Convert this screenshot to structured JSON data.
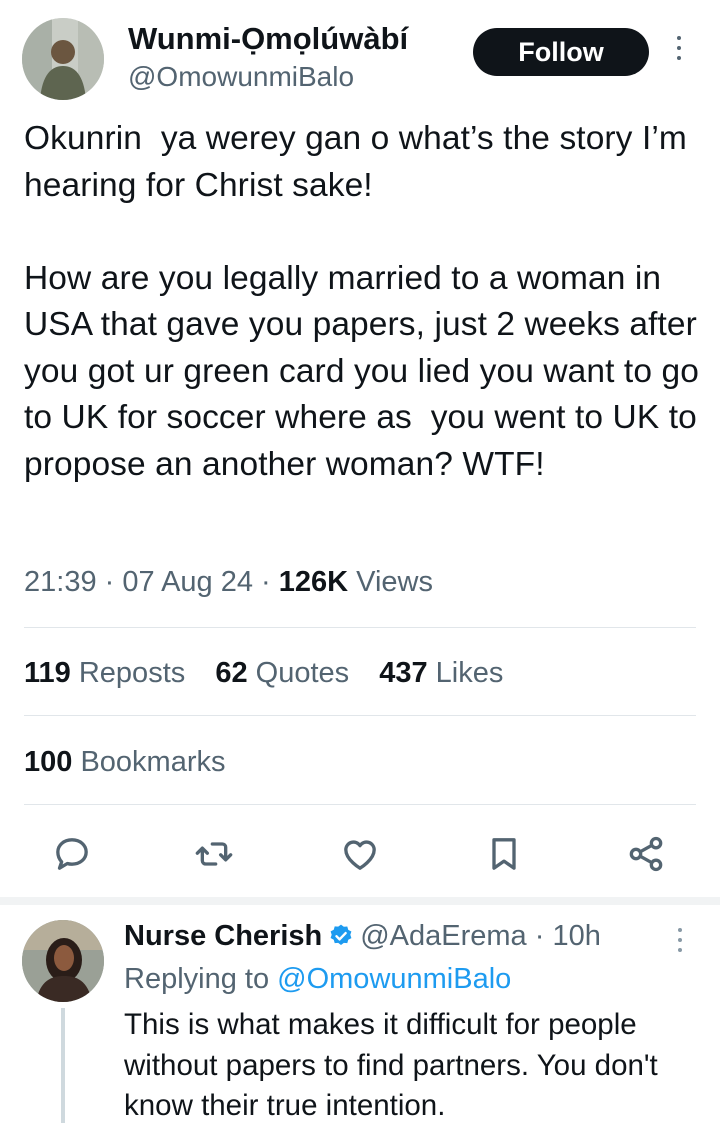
{
  "author": {
    "name": "Wunmi-Ọmọlúwàbí",
    "handle": "@OmowunmiBalo",
    "follow_label": "Follow"
  },
  "tweet": {
    "text": "Okunrin  ya werey gan o what’s the story I’m hearing for Christ sake!\n\nHow are you legally married to a woman in USA that gave you papers, just 2 weeks after you got ur green card you lied you want to go to UK for soccer where as  you went to UK to propose an another woman? WTF!",
    "time": "21:39",
    "date": "07 Aug 24",
    "views_count": "126K",
    "views_label": "Views"
  },
  "stats": {
    "reposts_count": "119",
    "reposts_label": "Reposts",
    "quotes_count": "62",
    "quotes_label": "Quotes",
    "likes_count": "437",
    "likes_label": "Likes",
    "bookmarks_count": "100",
    "bookmarks_label": "Bookmarks"
  },
  "actions": [
    "reply-icon",
    "repost-icon",
    "like-icon",
    "bookmark-icon",
    "share-icon"
  ],
  "reply": {
    "name": "Nurse Cherish",
    "handle": "@AdaErema",
    "age": "10h",
    "replying_prefix": "Replying to",
    "replying_to": "@OmowunmiBalo",
    "text": "This is what makes it difficult for people without papers to find partners. You don't know their true intention."
  },
  "colors": {
    "text": "#0f1419",
    "secondary": "#536471",
    "link": "#1d9bf0",
    "verified": "#1d9bf0",
    "divider": "#e1e6ea"
  }
}
